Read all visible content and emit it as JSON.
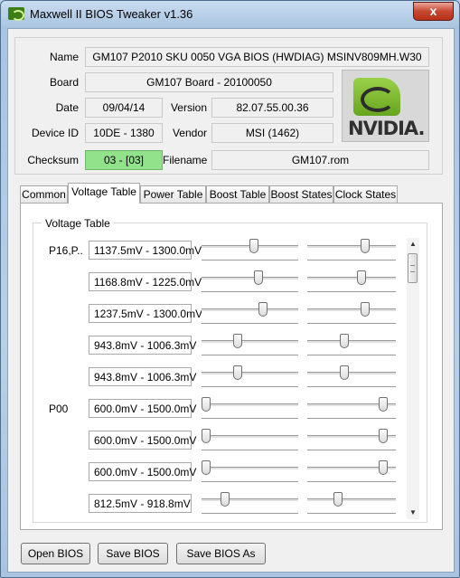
{
  "window": {
    "title": "Maxwell II BIOS Tweaker v1.36",
    "close_glyph": "x"
  },
  "info": {
    "name_label": "Name",
    "name_value": "GM107 P2010 SKU 0050 VGA BIOS (HWDIAG) MSINV809MH.W30",
    "board_label": "Board",
    "board_value": "GM107 Board - 20100050",
    "date_label": "Date",
    "date_value": "09/04/14",
    "version_label": "Version",
    "version_value": "82.07.55.00.36",
    "device_label": "Device ID",
    "device_value": "10DE - 1380",
    "vendor_label": "Vendor",
    "vendor_value": "MSI (1462)",
    "checksum_label": "Checksum",
    "checksum_value": "03 - [03]",
    "checksum_color": "#92e28c",
    "filename_label": "Filename",
    "filename_value": "GM107.rom",
    "logo_text": "NVIDIA."
  },
  "tabs": [
    "Common",
    "Voltage Table",
    "Power Table",
    "Boost Table",
    "Boost States",
    "Clock States"
  ],
  "active_tab": "Voltage Table",
  "voltage_table": {
    "group_title": "Voltage Table",
    "rows": [
      {
        "label": "P16,P..",
        "value": "1137.5mV - 1300.0mV",
        "slider1": 0.55,
        "slider2": 0.67
      },
      {
        "label": "",
        "value": "1168.8mV - 1225.0mV",
        "slider1": 0.6,
        "slider2": 0.62
      },
      {
        "label": "",
        "value": "1237.5mV - 1300.0mV",
        "slider1": 0.65,
        "slider2": 0.67
      },
      {
        "label": "",
        "value": "943.8mV - 1006.3mV",
        "slider1": 0.36,
        "slider2": 0.41
      },
      {
        "label": "",
        "value": "943.8mV - 1006.3mV",
        "slider1": 0.36,
        "slider2": 0.41
      },
      {
        "label": "P00",
        "value": "600.0mV - 1500.0mV",
        "slider1": 0.0,
        "slider2": 0.9
      },
      {
        "label": "",
        "value": "600.0mV - 1500.0mV",
        "slider1": 0.0,
        "slider2": 0.9
      },
      {
        "label": "",
        "value": "600.0mV - 1500.0mV",
        "slider1": 0.0,
        "slider2": 0.9
      },
      {
        "label": "",
        "value": "812.5mV - 918.8mV",
        "slider1": 0.22,
        "slider2": 0.33
      }
    ]
  },
  "buttons": {
    "open": "Open BIOS",
    "save": "Save BIOS",
    "save_as": "Save BIOS As"
  }
}
